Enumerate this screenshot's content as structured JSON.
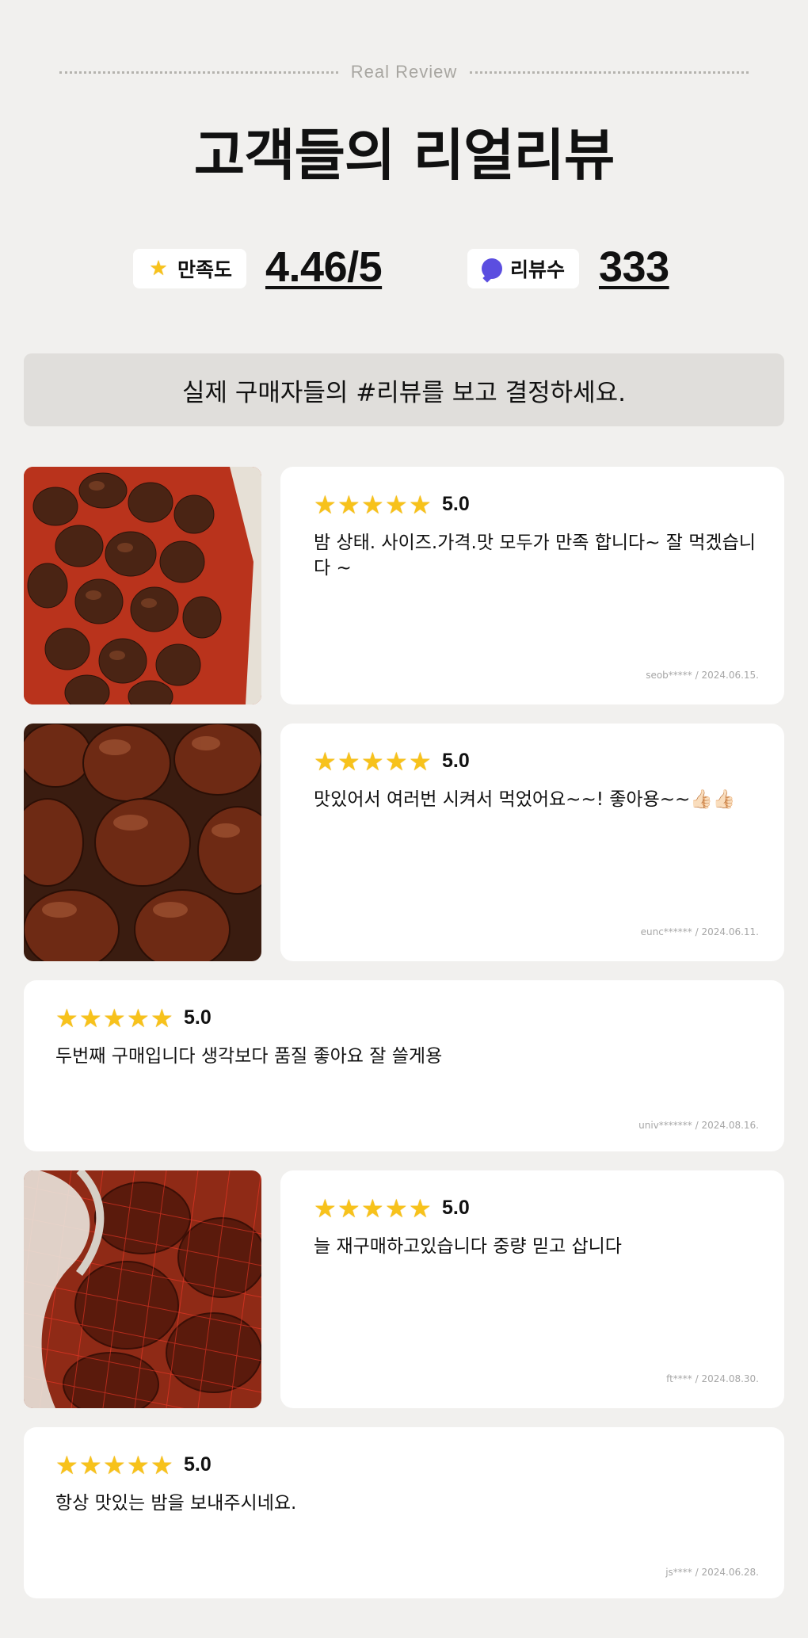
{
  "header": {
    "eyebrow": "Real Review",
    "title": "고객들의 리얼리뷰"
  },
  "stats": {
    "satisfaction_label": "만족도",
    "satisfaction_value": "4.46/5",
    "review_count_label": "리뷰수",
    "review_count_value": "333"
  },
  "banner": "실제 구매자들의 #리뷰를 보고 결정하세요.",
  "reviews": [
    {
      "rating": 5,
      "score": "5.0",
      "text": "밤 상태. 사이즈.가격.맛 모두가 만족 합니다~ 잘 먹겠습니다 ~",
      "author": "seob*****",
      "date": "2024.06.15.",
      "has_photo": true,
      "photo": "chestnuts-in-red-mesh-bag"
    },
    {
      "rating": 5,
      "score": "5.0",
      "text": "맛있어서 여러번 시켜서 먹었어요~~! 좋아용~~👍🏻👍🏻",
      "author": "eunc******",
      "date": "2024.06.11.",
      "has_photo": true,
      "photo": "shiny-chestnuts-closeup"
    },
    {
      "rating": 5,
      "score": "5.0",
      "text": "두번째 구매입니다 생각보다 품질 좋아요 잘 쓸게용",
      "author": "univ*******",
      "date": "2024.08.16.",
      "has_photo": false
    },
    {
      "rating": 5,
      "score": "5.0",
      "text": "늘 재구매하고있습니다 중량 믿고 삽니다",
      "author": "ft****",
      "date": "2024.08.30.",
      "has_photo": true,
      "photo": "chestnuts-red-net-closeup"
    },
    {
      "rating": 5,
      "score": "5.0",
      "text": "항상 맛있는 밤을 보내주시네요.",
      "author": "js****",
      "date": "2024.06.28.",
      "has_photo": false
    }
  ],
  "colors": {
    "background": "#f1f0ee",
    "star": "#f7c21b",
    "chat_icon": "#5b4ee0",
    "banner": "#e0dedb"
  }
}
